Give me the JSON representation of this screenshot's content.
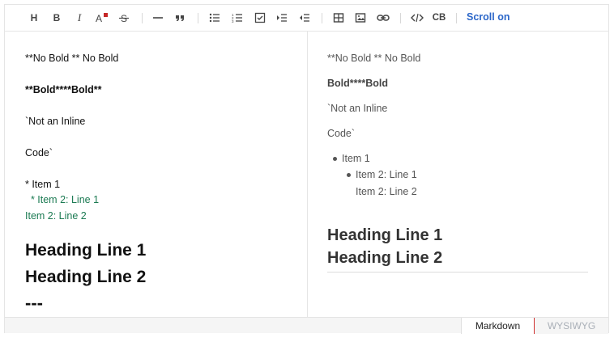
{
  "toolbar": {
    "heading": "H",
    "bold": "B",
    "italic": "I",
    "codeblock": "CB",
    "scroll_toggle": "Scroll on",
    "icons": [
      "heading-icon",
      "bold-icon",
      "italic-icon",
      "text-color-icon",
      "strike-icon",
      "hr-icon",
      "quote-icon",
      "bullet-list-icon",
      "ordered-list-icon",
      "task-list-icon",
      "indent-icon",
      "outdent-icon",
      "table-icon",
      "image-icon",
      "link-icon",
      "code-icon",
      "codeblock-icon"
    ],
    "accent_color": "#2c67c9"
  },
  "markdown": {
    "line1": "**No Bold ** No Bold",
    "line2": "**Bold****Bold**",
    "line3": "`Not an Inline",
    "line4": "Code`",
    "line5": "* Item 1",
    "line6": "  * Item 2: Line 1",
    "line7": "Item 2: Line 2",
    "line8": "Heading Line 1",
    "line9": "Heading Line 2",
    "line10": "---"
  },
  "preview": {
    "line1": "**No Bold ** No Bold",
    "line2": "Bold****Bold",
    "line3": "`Not an Inline",
    "line4": "Code`",
    "item1": "Item 1",
    "item2a": "Item 2: Line 1",
    "item2b": "Item 2: Line 2",
    "heading1": "Heading Line 1",
    "heading2": "Heading Line 2"
  },
  "modes": {
    "markdown": "Markdown",
    "wysiwyg": "WYSIWYG",
    "active": "Markdown"
  }
}
